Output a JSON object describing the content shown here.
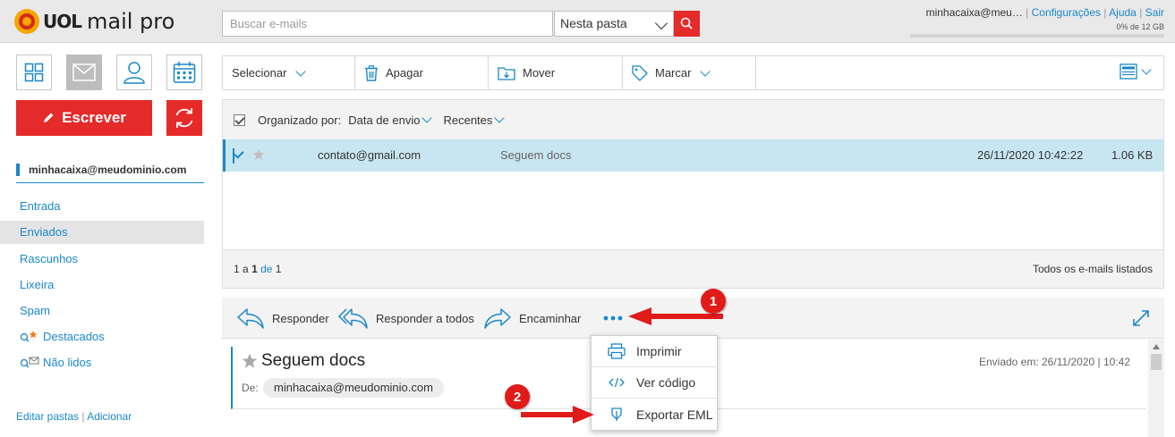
{
  "header": {
    "logo_brand": "UOL",
    "logo_product": "mail pro",
    "search_placeholder": "Buscar e-mails",
    "folder_select": "Nesta pasta",
    "user": "minhacaixa@meu…",
    "settings": "Configurações",
    "help": "Ajuda",
    "logout": "Sair",
    "quota": "0% de 12 GB"
  },
  "sidebar": {
    "write_label": "Escrever",
    "account": "minhacaixa@meudominio.com",
    "folders": [
      {
        "label": "Entrada"
      },
      {
        "label": "Enviados"
      },
      {
        "label": "Rascunhos"
      },
      {
        "label": "Lixeira"
      },
      {
        "label": "Spam"
      },
      {
        "label": "Destacados"
      },
      {
        "label": "Não lidos"
      }
    ],
    "edit_folders": "Editar pastas",
    "add_folder": "Adicionar"
  },
  "toolbar": {
    "select": "Selecionar",
    "delete": "Apagar",
    "move": "Mover",
    "mark": "Marcar"
  },
  "list": {
    "organized_by": "Organizado por:",
    "sort_field": "Data de envio",
    "sort_order": "Recentes",
    "emails": [
      {
        "from": "contato@gmail.com",
        "subject": "Seguem docs",
        "date": "26/11/2020 10:42:22",
        "size": "1.06 KB"
      }
    ],
    "pagination": {
      "start": "1",
      "a": "a",
      "end": "1",
      "de": "de",
      "total": "1"
    },
    "all_listed": "Todos os e-mails listados"
  },
  "reader": {
    "reply": "Responder",
    "reply_all": "Responder a todos",
    "forward": "Encaminhar",
    "subject": "Seguem docs",
    "sent_label": "Enviado em: 26/11/2020 | 10:42",
    "to_label": "De:",
    "to_value": "minhacaixa@meudominio.com"
  },
  "more_menu": {
    "items": [
      {
        "label": "Imprimir"
      },
      {
        "label": "Ver código"
      },
      {
        "label": "Exportar EML"
      }
    ]
  },
  "annotations": {
    "step1": "1",
    "step2": "2"
  },
  "colors": {
    "brand_red": "#e52a2a",
    "link_blue": "#1a87c9",
    "selected_row": "#c8e6f1"
  }
}
